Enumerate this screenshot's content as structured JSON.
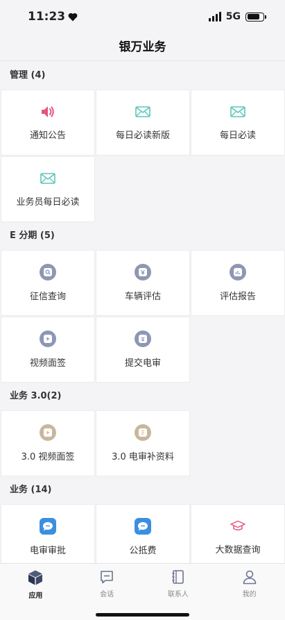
{
  "status_bar": {
    "time": "11:23",
    "network": "5G",
    "battery_percent": 80
  },
  "header": {
    "title": "银万业务"
  },
  "sections": [
    {
      "title": "管理 (4)",
      "items": [
        {
          "label": "通知公告",
          "icon": "speaker-icon"
        },
        {
          "label": "每日必读新版",
          "icon": "envelope-icon"
        },
        {
          "label": "每日必读",
          "icon": "envelope-icon"
        },
        {
          "label": "业务员每日必读",
          "icon": "envelope-icon"
        }
      ]
    },
    {
      "title": "E 分期 (5)",
      "items": [
        {
          "label": "征信查询",
          "icon": "search-doc-icon"
        },
        {
          "label": "车辆评估",
          "icon": "money-doc-icon"
        },
        {
          "label": "评估报告",
          "icon": "report-icon"
        },
        {
          "label": "视频面签",
          "icon": "video-icon"
        },
        {
          "label": "提交电审",
          "icon": "submit-icon"
        }
      ]
    },
    {
      "title": "业务 3.0(2)",
      "items": [
        {
          "label": "3.0 视频面签",
          "icon": "video-icon"
        },
        {
          "label": "3.0 电审补资料",
          "icon": "document-icon"
        }
      ]
    },
    {
      "title": "业务 (14)",
      "items": [
        {
          "label": "电审审批",
          "icon": "chat-icon"
        },
        {
          "label": "公抵费",
          "icon": "chat-icon"
        },
        {
          "label": "大数据查询",
          "icon": "graduation-cap-icon"
        }
      ]
    }
  ],
  "tabbar": {
    "tabs": [
      {
        "label": "应用",
        "icon": "cube-icon",
        "active": true
      },
      {
        "label": "会话",
        "icon": "message-icon",
        "active": false
      },
      {
        "label": "联系人",
        "icon": "contacts-book-icon",
        "active": false
      },
      {
        "label": "我的",
        "icon": "person-icon",
        "active": false
      }
    ]
  },
  "colors": {
    "accent_pink": "#e2577b",
    "accent_teal": "#5cc6b8",
    "icon_slate": "#8e97b3",
    "icon_tan": "#c9b79b",
    "icon_blue": "#3b8fe2"
  }
}
